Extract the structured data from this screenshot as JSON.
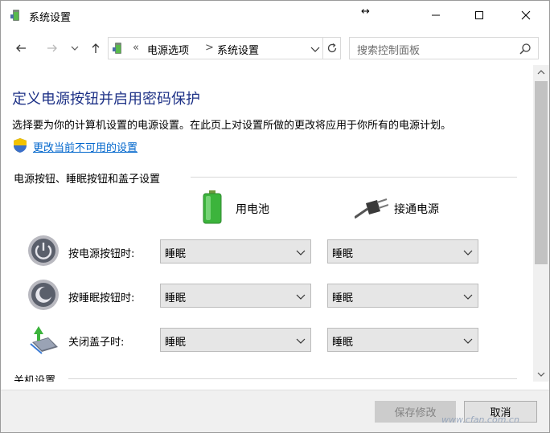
{
  "window": {
    "title": "系统设置",
    "resize_glyph": "↔"
  },
  "nav": {
    "address_prefix": "«",
    "breadcrumb": [
      "电源选项",
      "系统设置"
    ],
    "breadcrumb_sep": ">",
    "search_placeholder": "搜索控制面板"
  },
  "main": {
    "title": "定义电源按钮并启用密码保护",
    "description": "选择要为你的计算机设置的电源设置。在此页上对设置所做的更改将应用于你所有的电源计划。",
    "change_link": "更改当前不可用的设置",
    "section_buttons": "电源按钮、睡眠按钮和盖子设置",
    "section_shutdown": "关机设置",
    "columns": {
      "battery": "用电池",
      "plugged": "接通电源"
    },
    "rows": [
      {
        "label": "按电源按钮时:",
        "battery": "睡眠",
        "plugged": "睡眠"
      },
      {
        "label": "按睡眠按钮时:",
        "battery": "睡眠",
        "plugged": "睡眠"
      },
      {
        "label": "关闭盖子时:",
        "battery": "睡眠",
        "plugged": "睡眠"
      }
    ]
  },
  "footer": {
    "save": "保存修改",
    "cancel": "取消",
    "watermark": "www.cfan.com.cn"
  },
  "colors": {
    "title_blue": "#1e3287",
    "link_blue": "#0066cc",
    "battery_green": "#3cb43c"
  }
}
